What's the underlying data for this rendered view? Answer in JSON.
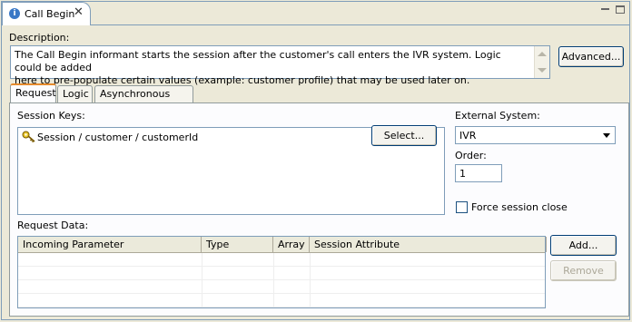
{
  "editor_tab": {
    "title": "Call Begin",
    "close_symbol": "✕",
    "icon": "info-icon"
  },
  "description": {
    "label": "Description:",
    "text": "The Call Begin informant starts the session after the customer's call  enters the IVR system.  Logic could be added\nhere to pre-populate certain values (example: customer profile) that may be used later on."
  },
  "buttons": {
    "advanced": "Advanced...",
    "select": "Select...",
    "add": "Add...",
    "remove": "Remove"
  },
  "inner_tabs": [
    {
      "label": "Request",
      "active": true
    },
    {
      "label": "Logic",
      "active": false
    },
    {
      "label": "Asynchronous Logic",
      "active": false
    }
  ],
  "session_keys": {
    "label": "Session Keys:",
    "items": [
      {
        "text": "Session / customer / customerId",
        "icon": "key-icon"
      }
    ]
  },
  "external_system": {
    "label": "External System:",
    "value": "IVR"
  },
  "order": {
    "label": "Order:",
    "value": "1"
  },
  "force_close": {
    "label": "Force session close",
    "checked": false
  },
  "request_data": {
    "label": "Request Data:",
    "columns": [
      "Incoming Parameter",
      "Type",
      "Array",
      "Session Attribute"
    ],
    "rows": []
  }
}
